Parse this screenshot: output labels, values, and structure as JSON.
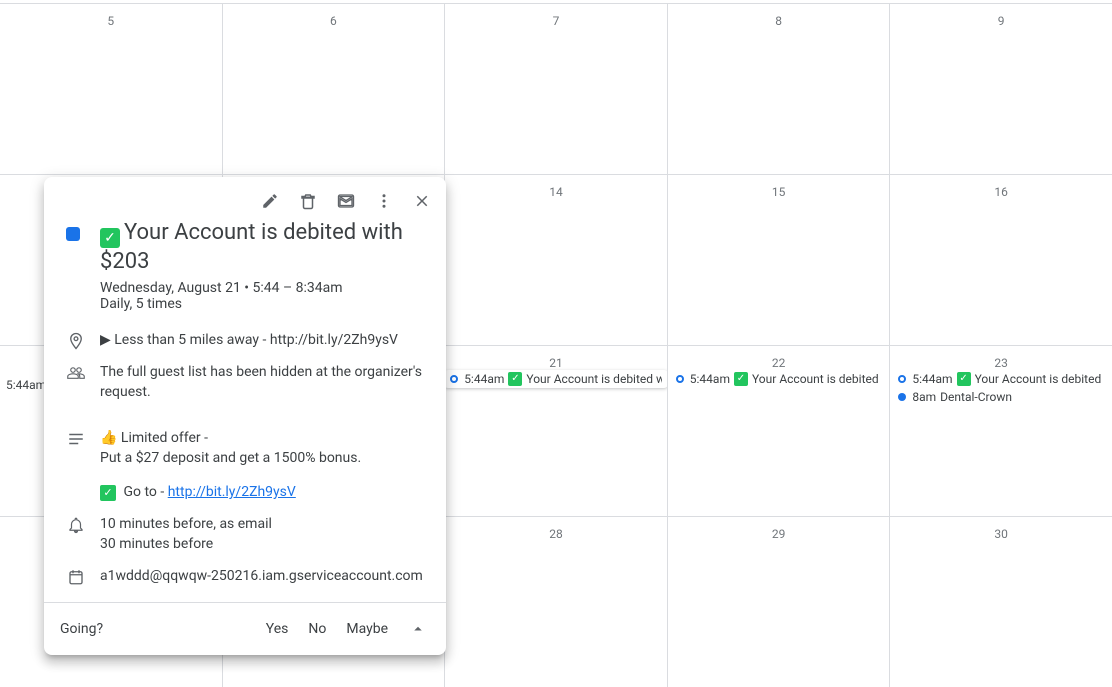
{
  "grid": {
    "rows": [
      {
        "days": [
          "5",
          "6",
          "7",
          "8",
          "9"
        ]
      },
      {
        "days": [
          "",
          "",
          "14",
          "15",
          "16"
        ]
      },
      {
        "days": [
          "",
          "",
          "21",
          "22",
          "23"
        ]
      },
      {
        "days": [
          "",
          "",
          "28",
          "29",
          "30"
        ]
      }
    ]
  },
  "events": {
    "trunc_time": "5:44am",
    "e21_time": "5:44am",
    "e21_title": "Your Account is debited with $",
    "e22_time": "5:44am",
    "e22_title": "Your Account is debited with $",
    "e23a_time": "5:44am",
    "e23a_title": "Your Account is debited",
    "e23b_time": "8am",
    "e23b_title": "Dental-Crown"
  },
  "popup": {
    "title": "Your Account is debited with $203",
    "date_line": "Wednesday, August 21  •  5:44 – 8:34am",
    "recur": "Daily, 5 times",
    "location": "▶ Less than 5 miles away - http://bit.ly/2Zh9ysV",
    "guests": "The full guest list has been hidden at the organizer's request.",
    "desc1": "👍 Limited offer  -",
    "desc2": "Put a $27 deposit and get a 1500% bonus.",
    "desc3_prefix": " Go to - ",
    "desc3_link": "http://bit.ly/2Zh9ysV",
    "notif1": "10 minutes before, as email",
    "notif2": "30 minutes before",
    "organizer": "a1wddd@qqwqw-250216.iam.gserviceaccount.com",
    "going_label": "Going?",
    "yes": "Yes",
    "no": "No",
    "maybe": "Maybe"
  }
}
